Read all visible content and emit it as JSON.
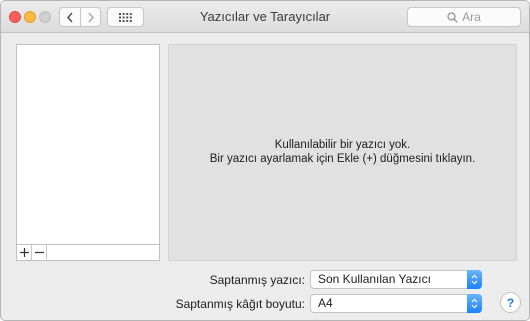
{
  "window": {
    "title": "Yazıcılar ve Tarayıcılar"
  },
  "toolbar": {
    "back_icon": "chevron-left-icon",
    "forward_icon": "chevron-right-icon",
    "grid_icon": "show-all-grid-icon",
    "search_placeholder": "Ara"
  },
  "printer_list": {
    "items": [],
    "add_label": "+",
    "remove_label": "−"
  },
  "detail": {
    "line1": "Kullanılabilir bir yazıcı yok.",
    "line2": "Bir yazıcı ayarlamak için Ekle (+) düğmesini tıklayın."
  },
  "settings": {
    "default_printer_label": "Saptanmış yazıcı:",
    "default_printer_value": "Son Kullanılan Yazıcı",
    "paper_size_label": "Saptanmış kâğıt boyutu:",
    "paper_size_value": "A4"
  },
  "help": {
    "label": "?"
  },
  "colors": {
    "close": "#fc605c",
    "minimize": "#fdbc40",
    "zoom_disabled": "#cfcfcf",
    "accent": "#1a82fb"
  }
}
